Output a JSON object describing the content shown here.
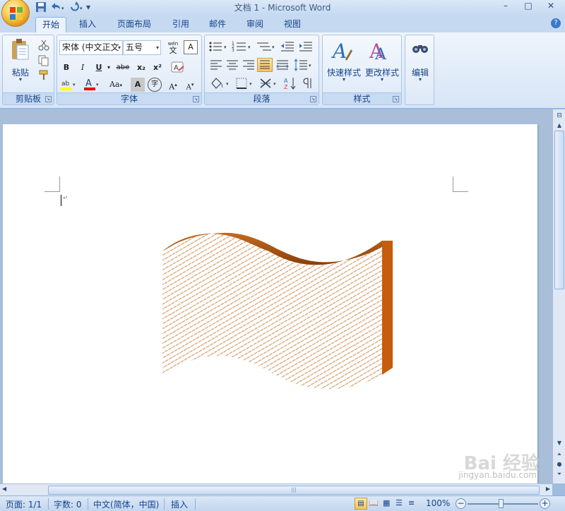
{
  "window": {
    "title": "文档 1 - Microsoft Word",
    "minimize": "–",
    "maximize": "□",
    "close": "✕"
  },
  "qat": {
    "save_icon": "save-icon",
    "undo_icon": "undo-icon",
    "redo_icon": "redo-icon",
    "customize": "▾"
  },
  "tabs": [
    {
      "label": "开始",
      "active": true
    },
    {
      "label": "插入"
    },
    {
      "label": "页面布局"
    },
    {
      "label": "引用"
    },
    {
      "label": "邮件"
    },
    {
      "label": "审阅"
    },
    {
      "label": "视图"
    }
  ],
  "ribbon": {
    "clipboard": {
      "label": "剪贴板",
      "paste": "粘贴",
      "paste_arrow": "▾"
    },
    "font": {
      "label": "字体",
      "font_name": "宋体 (中文正文",
      "font_size": "五号",
      "bold": "B",
      "italic": "I",
      "underline": "U",
      "strike": "abe",
      "subscript": "x₂",
      "superscript": "x²",
      "grow": "A",
      "shrink": "A",
      "change_case": "Aa",
      "wen": "wén",
      "wen_char": "文",
      "char_border": "A",
      "char_shade": "A",
      "enclose": "字"
    },
    "paragraph": {
      "label": "段落"
    },
    "styles": {
      "label": "样式",
      "quick_styles": "快速样式",
      "change_styles": "更改样式"
    },
    "editing": {
      "label": "编辑"
    }
  },
  "statusbar": {
    "page": "页面: 1/1",
    "words": "字数: 0",
    "language": "中文(简体，中国)",
    "insert_mode": "插入",
    "zoom": "100%"
  },
  "watermark": {
    "text": "Bai 经验",
    "sub": "jingyan.baidu.com"
  },
  "colors": {
    "shape_fill": "#c65c0c",
    "shape_dark": "#8a3f08",
    "hatch": "#d4a070"
  }
}
